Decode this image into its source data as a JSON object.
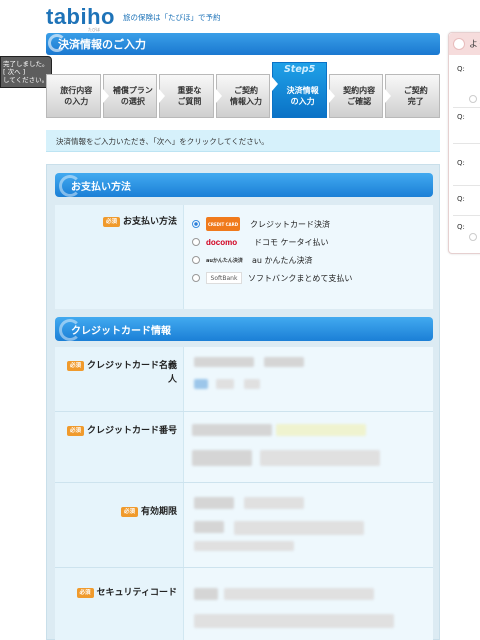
{
  "header": {
    "logo_text": "tabiho",
    "tagline": "旅の保険は「たびほ」で予約",
    "logo_sub": "たびほ"
  },
  "side_tip": {
    "line1": "完了しました。",
    "line2": "[ 次へ ]",
    "line3": "してください。"
  },
  "page_title": "決済情報のご入力",
  "steps": [
    {
      "label_line1": "旅行内容",
      "label_line2": "の入力",
      "active": false
    },
    {
      "label_line1": "補償プラン",
      "label_line2": "の選択",
      "active": false
    },
    {
      "label_line1": "重要な",
      "label_line2": "ご質問",
      "active": false
    },
    {
      "label_line1": "ご契約",
      "label_line2": "情報入力",
      "active": false
    },
    {
      "label_line1": "決済情報",
      "label_line2": "の入力",
      "active": true,
      "badge": "Step5"
    },
    {
      "label_line1": "契約内容",
      "label_line2": "ご確認",
      "active": false
    },
    {
      "label_line1": "ご契約",
      "label_line2": "完了",
      "active": false
    }
  ],
  "instruction": "決済情報をご入力いただき、「次へ」をクリックしてください。",
  "payment_section": {
    "heading": "お支払い方法",
    "required_label": "必須",
    "field_label": "お支払い方法",
    "options": [
      {
        "logo": "CREDIT CARD",
        "label": "クレジットカード決済",
        "selected": true
      },
      {
        "logo": "docomo",
        "label": "ドコモ ケータイ払い",
        "selected": false
      },
      {
        "logo": "auかんたん決済",
        "label": "au かんたん決済",
        "selected": false
      },
      {
        "logo": "SoftBank",
        "label": "ソフトバンクまとめて支払い",
        "selected": false
      }
    ]
  },
  "credit_section": {
    "heading": "クレジットカード情報",
    "required_label": "必須",
    "fields": {
      "holder_line1": "クレジットカード名義",
      "holder_line2": "人",
      "number": "クレジットカード番号",
      "expiry": "有効期限",
      "security": "セキュリティコード"
    }
  },
  "faq_panel": {
    "heading": "よく",
    "q_label": "Q:"
  }
}
